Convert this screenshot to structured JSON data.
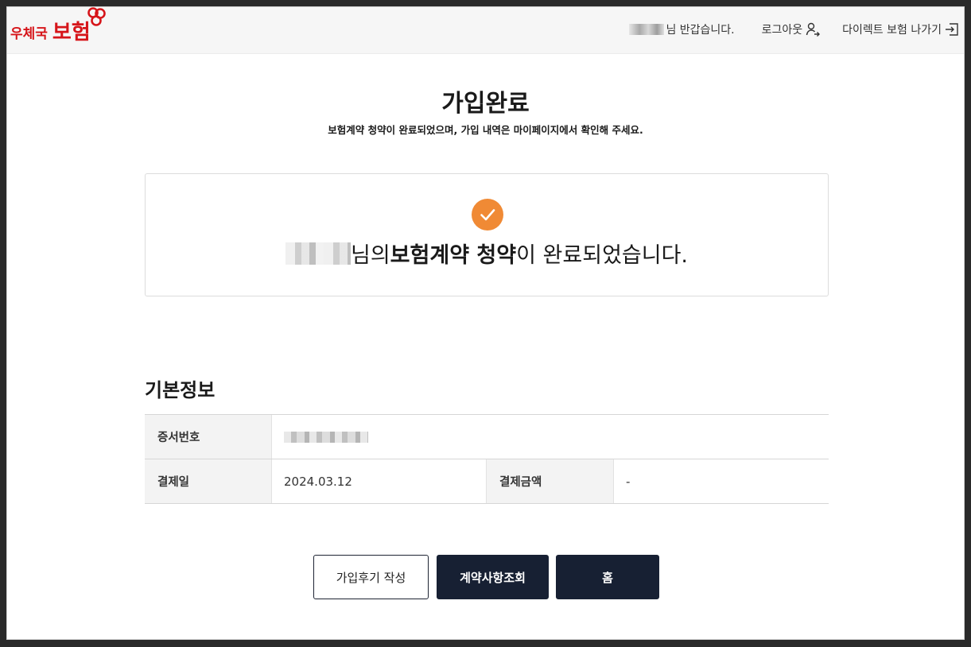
{
  "header": {
    "logo_small": "우체국",
    "logo_big": "보험",
    "welcome_suffix": "님 반갑습니다.",
    "logout_label": "로그아웃",
    "exit_label": "다이렉트 보험 나가기"
  },
  "main": {
    "title": "가입완료",
    "subtitle": "보험계약 청약이 완료되었으며, 가입 내역은 마이페이지에서 확인해 주세요.",
    "result": {
      "part1": "님의 ",
      "bold": "보험계약 청약",
      "part2": "이 완료되었습니다."
    }
  },
  "info": {
    "section_title": "기본정보",
    "cert_label": "증서번호",
    "pay_date_label": "결제일",
    "pay_date_value": "2024.03.12",
    "pay_amount_label": "결제금액",
    "pay_amount_value": "-"
  },
  "buttons": {
    "review": "가입후기 작성",
    "contract": "계약사항조회",
    "home": "홈"
  },
  "colors": {
    "brand_red": "#d6151a",
    "check_orange": "#f08a35",
    "button_dark": "#172033"
  }
}
